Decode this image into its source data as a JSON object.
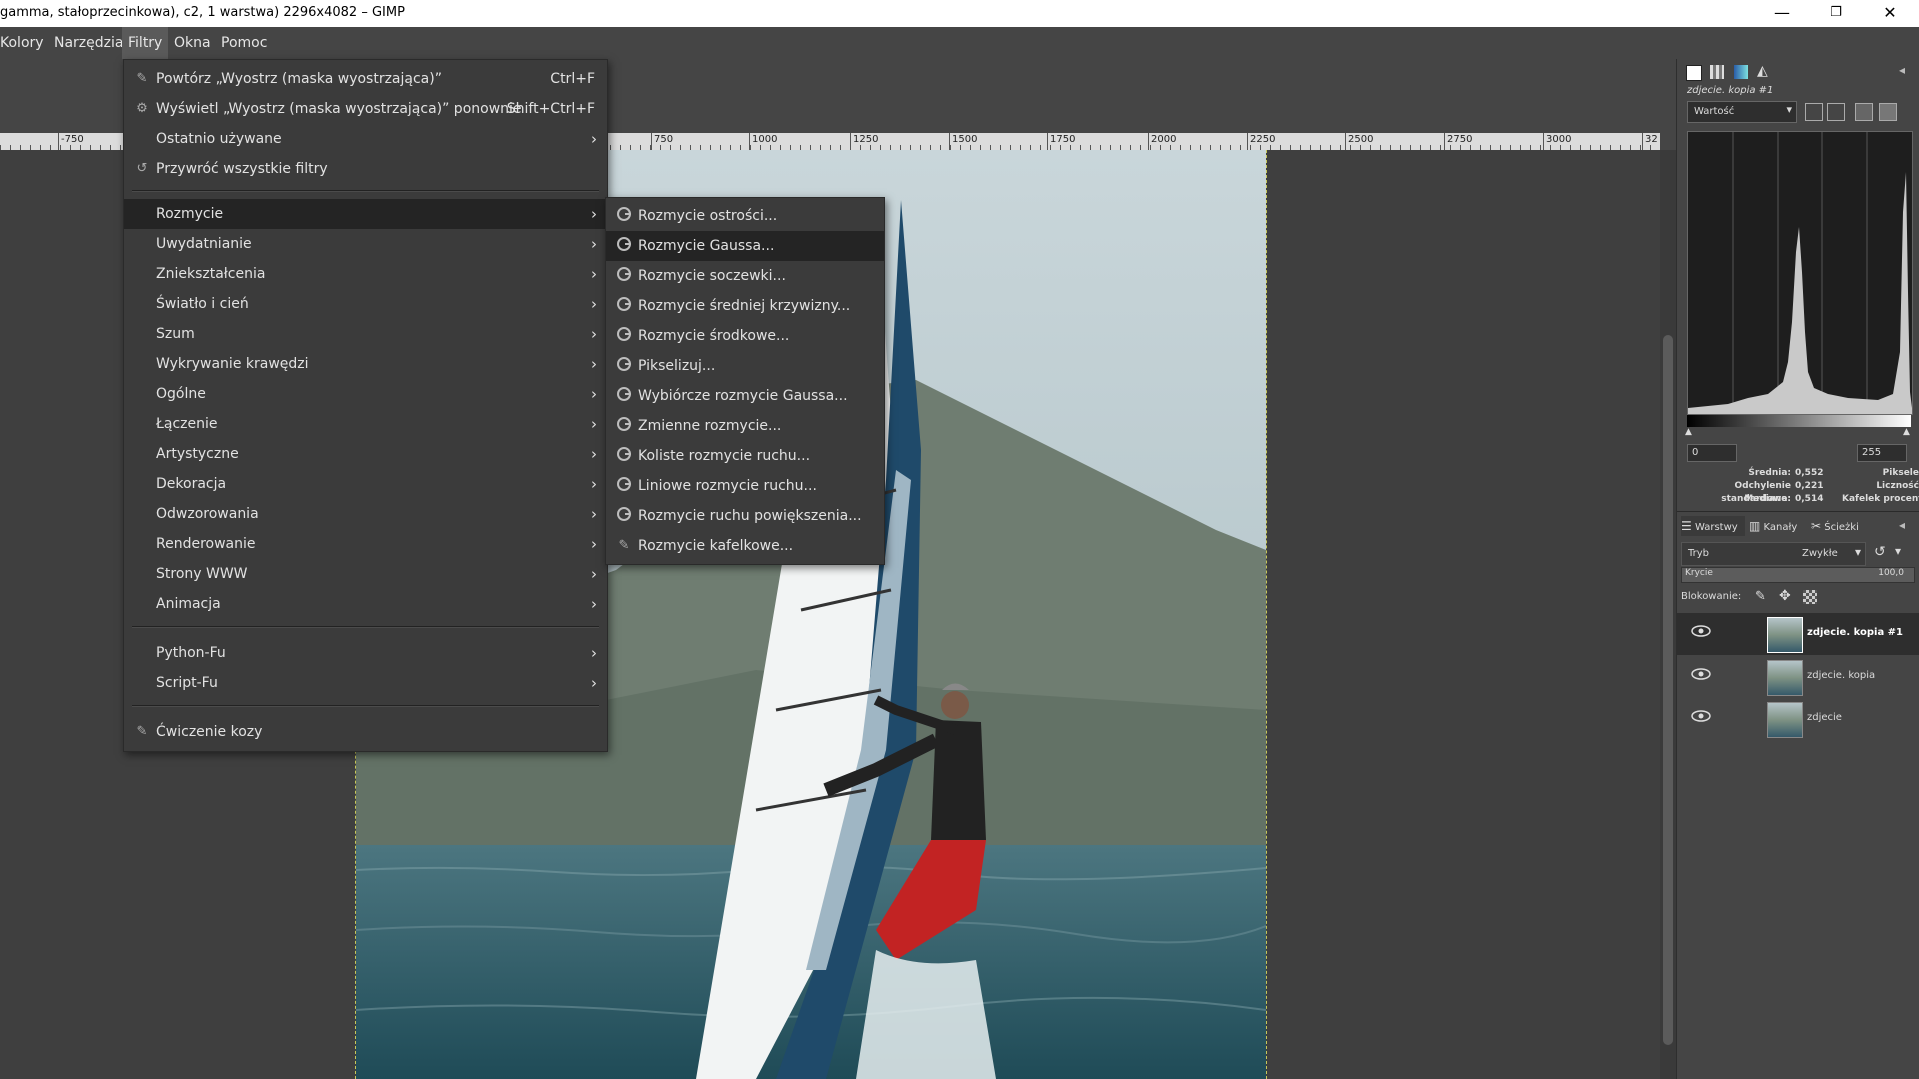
{
  "window": {
    "title": "gamma, stałoprzecinkowa), c2, 1 warstwa) 2296x4082 – GIMP",
    "minimize": "—",
    "maximize": "❐",
    "close": "✕"
  },
  "menubar": [
    "Kolory",
    "Narzędzia",
    "Filtry",
    "Okna",
    "Pomoc"
  ],
  "ruler": [
    "-750",
    "750",
    "1000",
    "1250",
    "1500",
    "1750",
    "2000",
    "2250",
    "2500",
    "2750",
    "3000",
    "32"
  ],
  "filters_menu": {
    "repeat": {
      "label": "Powtórz „Wyostrz (maska wyostrzająca)”",
      "shortcut": "Ctrl+F"
    },
    "reshow": {
      "label": "Wyświetl „Wyostrz (maska wyostrzająca)” ponownie",
      "shortcut": "Shift+Ctrl+F"
    },
    "recent": "Ostatnio używane",
    "reset": "Przywróć wszystkie filtry",
    "groups": [
      "Rozmycie",
      "Uwydatnianie",
      "Zniekształcenia",
      "Światło i cień",
      "Szum",
      "Wykrywanie krawędzi",
      "Ogólne",
      "Łączenie",
      "Artystyczne",
      "Dekoracja",
      "Odwzorowania",
      "Renderowanie",
      "Strony WWW",
      "Animacja"
    ],
    "scripts": [
      "Python-Fu",
      "Script-Fu"
    ],
    "goat": "Ćwiczenie kozy"
  },
  "blur_submenu": [
    "Rozmycie ostrości...",
    "Rozmycie Gaussa...",
    "Rozmycie soczewki...",
    "Rozmycie średniej krzywizny...",
    "Rozmycie środkowe...",
    "Pikselizuj...",
    "Wybiórcze rozmycie Gaussa...",
    "Zmienne rozmycie...",
    "Koliste rozmycie ruchu...",
    "Liniowe rozmycie ruchu...",
    "Rozmycie ruchu powiększenia...",
    "Rozmycie kafelkowe..."
  ],
  "histogram": {
    "layer_name": "zdjecie. kopia #1",
    "channel": "Wartość",
    "range_min": "0",
    "range_max": "255",
    "stats": {
      "mean_label": "Średnia:",
      "mean": "0,552",
      "std_label": "Odchylenie standardowe:",
      "std": "0,221",
      "median_label": "Mediana:",
      "median": "0,514",
      "pixels_label": "Piksele",
      "count_label": "Liczność",
      "percentile_label": "Kafelek procentu"
    }
  },
  "layers_panel": {
    "tabs": [
      "Warstwy",
      "Kanały",
      "Ścieżki"
    ],
    "mode_label": "Tryb",
    "mode_value": "Zwykłe",
    "opacity_label": "Krycie",
    "opacity_value": "100,0",
    "lock_label": "Blokowanie:",
    "layers": [
      "zdjecie. kopia #1",
      "zdjecie. kopia",
      "zdjecie"
    ]
  }
}
